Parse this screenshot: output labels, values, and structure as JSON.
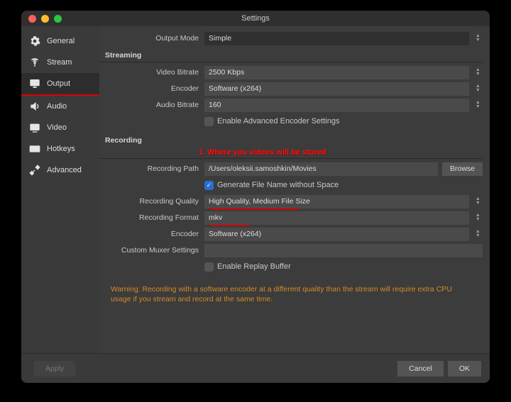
{
  "window": {
    "title": "Settings"
  },
  "sidebar": {
    "items": [
      {
        "label": "General"
      },
      {
        "label": "Stream"
      },
      {
        "label": "Output"
      },
      {
        "label": "Audio"
      },
      {
        "label": "Video"
      },
      {
        "label": "Hotkeys"
      },
      {
        "label": "Advanced"
      }
    ]
  },
  "output_mode": {
    "label": "Output Mode",
    "value": "Simple"
  },
  "streaming": {
    "header": "Streaming",
    "video_bitrate": {
      "label": "Video Bitrate",
      "value": "2500 Kbps"
    },
    "encoder": {
      "label": "Encoder",
      "value": "Software (x264)"
    },
    "audio_bitrate": {
      "label": "Audio Bitrate",
      "value": "160"
    },
    "enable_advanced": {
      "label": "Enable Advanced Encoder Settings",
      "checked": false
    }
  },
  "recording": {
    "header": "Recording",
    "annotation": "1. Where you videos will be stored",
    "path": {
      "label": "Recording Path",
      "value": "/Users/oleksii.samoshkin/Movies",
      "browse": "Browse"
    },
    "gen_filename": {
      "label": "Generate File Name without Space",
      "checked": true
    },
    "quality": {
      "label": "Recording Quality",
      "value": "High Quality, Medium File Size"
    },
    "format": {
      "label": "Recording Format",
      "value": "mkv"
    },
    "encoder": {
      "label": "Encoder",
      "value": "Software (x264)"
    },
    "muxer": {
      "label": "Custom Muxer Settings",
      "value": ""
    },
    "replay_buffer": {
      "label": "Enable Replay Buffer",
      "checked": false
    }
  },
  "warning": "Warning: Recording with a software encoder at a different quality than the stream will require extra CPU usage if you stream and record at the same time.",
  "footer": {
    "apply": "Apply",
    "cancel": "Cancel",
    "ok": "OK"
  }
}
